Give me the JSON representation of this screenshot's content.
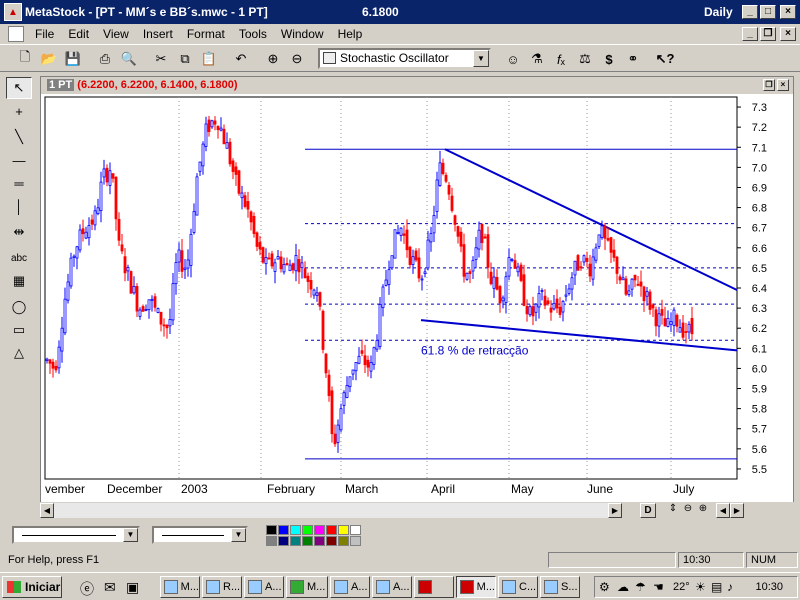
{
  "window": {
    "title": "MetaStock - [PT - MM´s e BB´s.mwc - 1 PT]",
    "price": "6.1800",
    "period": "Daily",
    "minimize": "_",
    "maximize": "□",
    "close": "×"
  },
  "menu": [
    "File",
    "Edit",
    "View",
    "Insert",
    "Format",
    "Tools",
    "Window",
    "Help"
  ],
  "toolbar": {
    "indicator_select": "Stochastic Oscillator",
    "icons": [
      "new-file-icon",
      "open-folder-icon",
      "save-icon",
      "print-icon",
      "print-preview-icon",
      "cut-icon",
      "copy-icon",
      "paste-icon",
      "undo-icon",
      "zoom-in-icon",
      "zoom-out-icon",
      "expert-advisor-icon",
      "explorer-icon",
      "formula-icon",
      "system-tester-icon",
      "dollar-icon",
      "binoculars-icon",
      "context-help-icon"
    ]
  },
  "left_tools": [
    "pointer-icon",
    "crosshair-icon",
    "trendline-icon",
    "horizontal-line-icon",
    "vertical-line-icon",
    "text-icon",
    "grid-icon",
    "ellipse-icon",
    "rectangle-icon",
    "triangle-icon"
  ],
  "chart": {
    "window_name": "1 PT",
    "ohlc": "(6.2200, 6.2200, 6.1400, 6.1800)",
    "annotation": "61.8 % de retracção",
    "y_ticks": [
      "7.3",
      "7.2",
      "7.1",
      "7.0",
      "6.9",
      "6.8",
      "6.7",
      "6.6",
      "6.5",
      "6.4",
      "6.3",
      "6.2",
      "6.1",
      "6.0",
      "5.9",
      "5.8",
      "5.7",
      "5.6",
      "5.5"
    ],
    "x_labels": [
      "vember",
      "December",
      "2003",
      "February",
      "March",
      "April",
      "May",
      "June",
      "July"
    ],
    "colors": {
      "up": "#0000ff",
      "down": "#ff0000",
      "lines": "#0000cc"
    }
  },
  "chart_data": {
    "type": "candlestick",
    "y_axis_range": [
      5.45,
      7.35
    ],
    "x_labels": [
      "vember",
      "December",
      "2003",
      "February",
      "March",
      "April",
      "May",
      "June",
      "July"
    ],
    "annotation": "61.8 % de retracção",
    "horizontal_levels": [
      7.09,
      6.72,
      6.5,
      6.32,
      6.14,
      5.55
    ],
    "last_close": 6.18
  },
  "bottom": {
    "palette": [
      "#000000",
      "#0000ff",
      "#00ffff",
      "#00ff00",
      "#ff00ff",
      "#ff0000",
      "#ffff00",
      "#ffffff",
      "#808080",
      "#000080",
      "#008080",
      "#008000",
      "#800080",
      "#800000",
      "#808000",
      "#c0c0c0"
    ]
  },
  "status": {
    "help": "For Help, press F1",
    "time": "10:30",
    "num": "NUM"
  },
  "taskbar": {
    "start": "Iniciar",
    "buttons": [
      "M...",
      "R...",
      "A...",
      "M...",
      "A...",
      "A...",
      "M...",
      "C...",
      "S..."
    ],
    "temp": "22°",
    "clock": "10:30"
  }
}
